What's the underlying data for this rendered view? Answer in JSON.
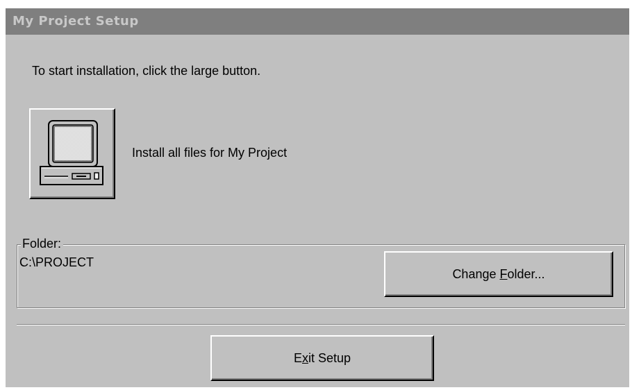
{
  "window": {
    "title": "My Project Setup"
  },
  "instruction_text": "To start installation, click the large button.",
  "install": {
    "icon": "computer-icon",
    "label": "Install all files for My Project"
  },
  "folder": {
    "group_label": "Folder:",
    "path": "C:\\PROJECT",
    "change_button": {
      "before": "Change ",
      "mnemonic": "F",
      "after": "older..."
    }
  },
  "exit_button": {
    "before": "E",
    "mnemonic": "x",
    "after": "it Setup"
  },
  "colors": {
    "face": "#c0c0c0",
    "titlebar_inactive": "#7f7f7f",
    "title_text": "#c8c8c8"
  }
}
